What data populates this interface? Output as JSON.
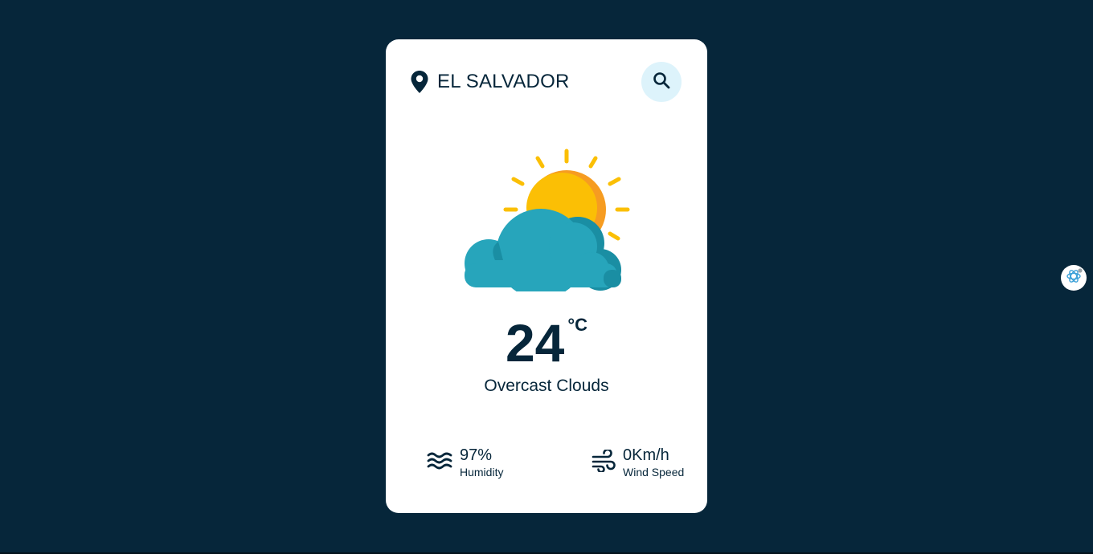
{
  "location": {
    "name": "EL SALVADOR",
    "icon": "map-pin-icon"
  },
  "search": {
    "icon": "search-icon"
  },
  "weather": {
    "illustration": "sun-behind-cloud-icon",
    "temperature": "24",
    "unit": "°C",
    "condition": "Overcast Clouds"
  },
  "details": {
    "humidity": {
      "icon": "humidity-waves-icon",
      "value": "97%",
      "label": "Humidity"
    },
    "wind": {
      "icon": "wind-icon",
      "value": "0Km/h",
      "label": "Wind Speed"
    }
  },
  "colors": {
    "background": "#06263A",
    "card": "#FFFFFF",
    "text": "#06263A",
    "search_bg": "#DDF3FB",
    "sun": "#FBBF05",
    "sun_shade": "#F69C21",
    "cloud": "#27A5BB",
    "cloud_shade": "#1A8EA3"
  },
  "assistant_button": {
    "icon": "assistant-icon"
  }
}
